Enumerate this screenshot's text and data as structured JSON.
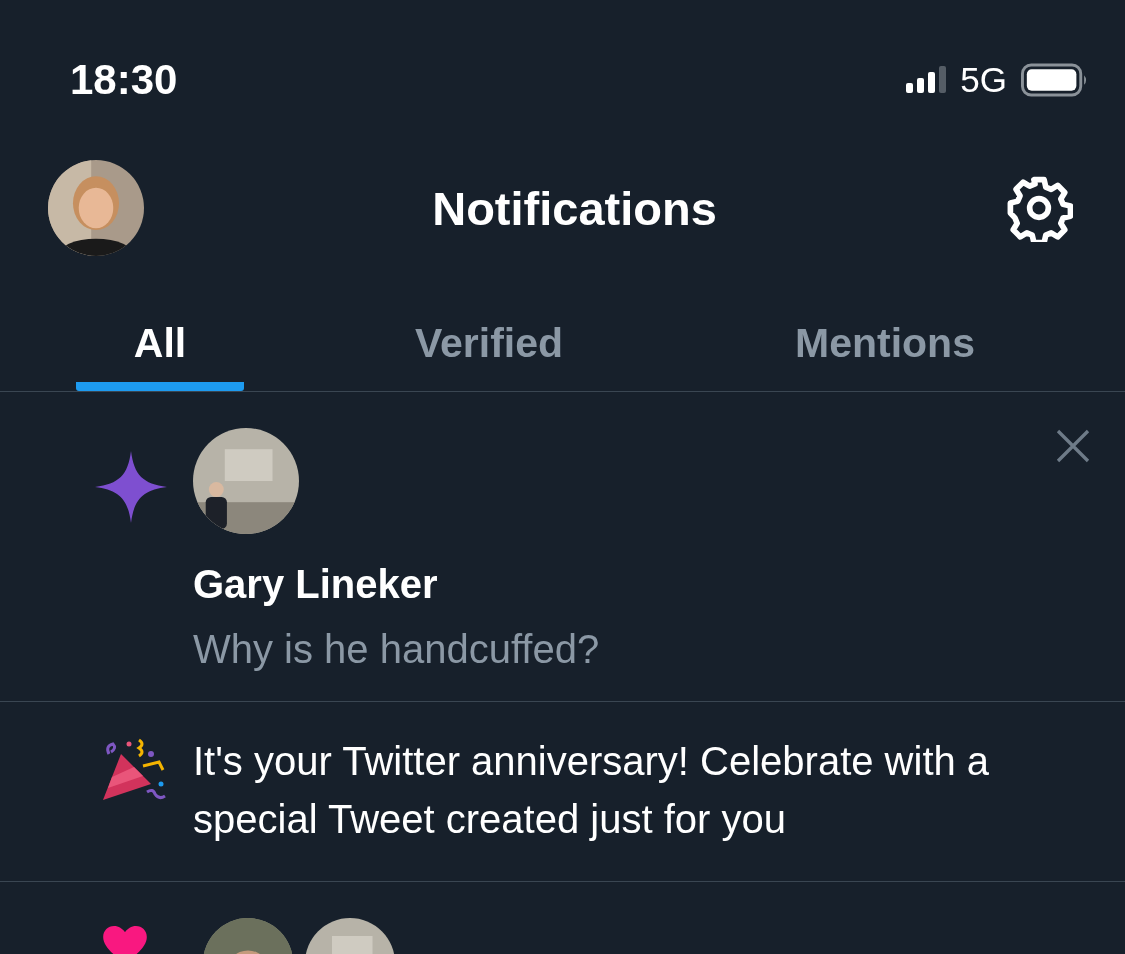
{
  "status_bar": {
    "time": "18:30",
    "network": "5G"
  },
  "header": {
    "title": "Notifications"
  },
  "tabs": [
    {
      "label": "All",
      "selected": true
    },
    {
      "label": "Verified",
      "selected": false
    },
    {
      "label": "Mentions",
      "selected": false
    }
  ],
  "notifications": [
    {
      "kind": "highlight",
      "name": "Gary Lineker",
      "text": "Why is he handcuffed?"
    },
    {
      "kind": "anniversary",
      "text": "It's your Twitter anniversary! Celebrate with a special Tweet created just for you"
    },
    {
      "kind": "like"
    }
  ]
}
